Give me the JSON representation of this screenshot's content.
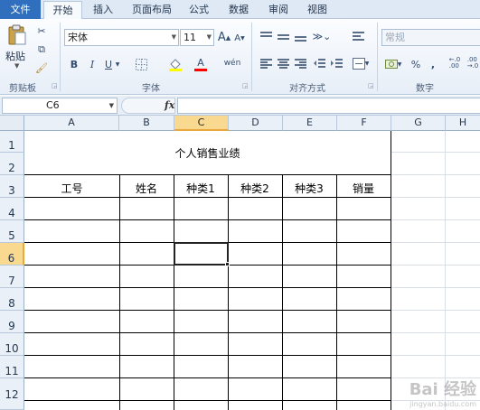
{
  "menu": {
    "tabs": [
      "文件",
      "开始",
      "插入",
      "页面布局",
      "公式",
      "数据",
      "审阅",
      "视图"
    ],
    "active_tab": "开始"
  },
  "ribbon": {
    "clipboard": {
      "paste_label": "粘贴",
      "group_label": "剪贴板"
    },
    "font": {
      "font_name": "宋体",
      "font_size": "11",
      "grow_label": "A",
      "shrink_label": "A",
      "bold_label": "B",
      "italic_label": "I",
      "underline_label": "U",
      "font_color_label": "A",
      "phonetic_label": "wén",
      "group_label": "字体"
    },
    "alignment": {
      "group_label": "对齐方式"
    },
    "number": {
      "format": "常规",
      "percent_label": "%",
      "comma_label": ",",
      "group_label": "数字"
    }
  },
  "formula_bar": {
    "cell_ref": "C6",
    "fx_label": "fx",
    "content": ""
  },
  "columns": [
    "A",
    "B",
    "C",
    "D",
    "E",
    "F",
    "G",
    "H"
  ],
  "selected_column": "C",
  "rows": [
    "1",
    "2",
    "3",
    "4",
    "5",
    "6",
    "7",
    "8",
    "9",
    "10",
    "11",
    "12"
  ],
  "selected_row": "6",
  "sheet": {
    "title": "个人销售业绩",
    "headers": [
      "工号",
      "姓名",
      "种类1",
      "种类2",
      "种类3",
      "销量"
    ]
  },
  "watermark": {
    "text": "Bai 经验",
    "sub": "jingyan.baidu.com"
  }
}
